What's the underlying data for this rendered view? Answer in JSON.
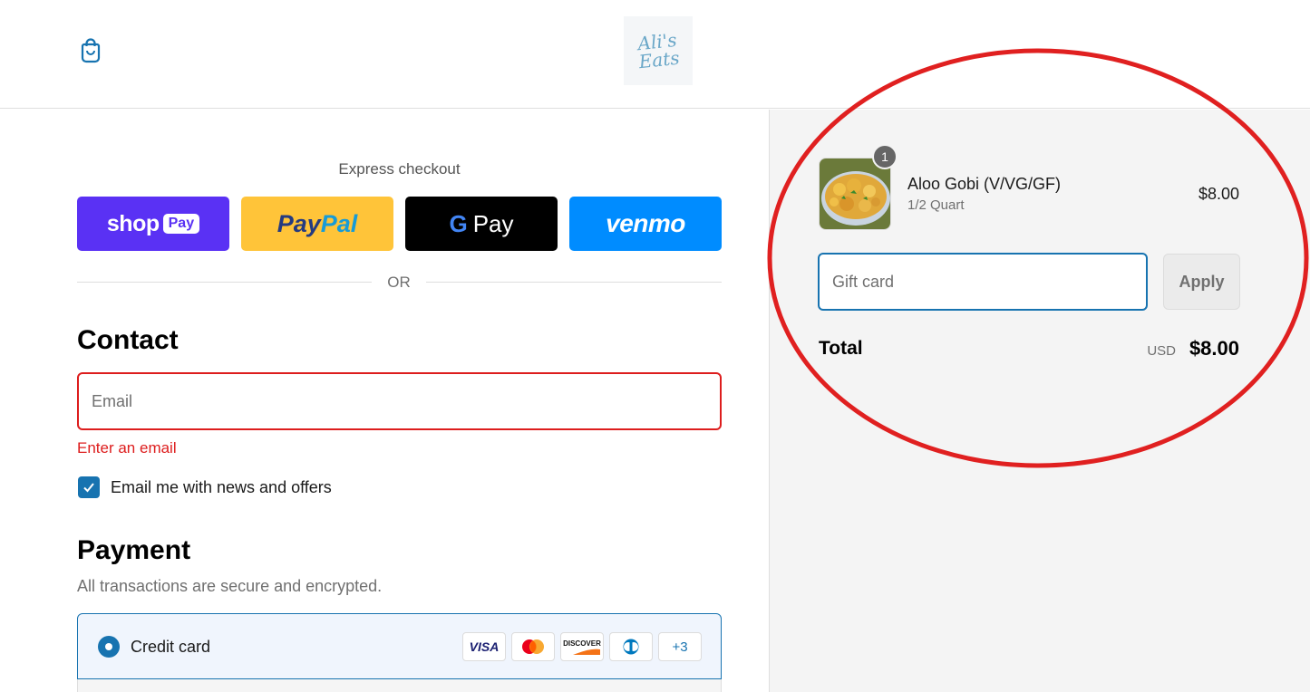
{
  "header": {
    "logo_text": "Ali's Eats",
    "cart_icon": "shopping-bag-icon"
  },
  "express": {
    "title": "Express checkout",
    "shop_pay": {
      "word": "shop",
      "pill": "Pay"
    },
    "paypal": {
      "part1": "Pay",
      "part2": "Pal"
    },
    "google_pay": {
      "g": "G",
      "pay": "Pay"
    },
    "venmo": "venmo",
    "divider": "OR"
  },
  "contact": {
    "heading": "Contact",
    "email_placeholder": "Email",
    "error": "Enter an email",
    "newsletter_label": "Email me with news and offers",
    "newsletter_checked": true
  },
  "payment": {
    "heading": "Payment",
    "subtitle": "All transactions are secure and encrypted.",
    "method_label": "Credit card",
    "cards": [
      "VISA",
      "mastercard",
      "DISCOVER",
      "diners-club"
    ],
    "more_cards": "+3"
  },
  "summary": {
    "item": {
      "name": "Aloo Gobi (V/VG/GF)",
      "variant": "1/2 Quart",
      "price": "$8.00",
      "quantity": "1"
    },
    "gift_card_placeholder": "Gift card",
    "apply_label": "Apply",
    "total_label": "Total",
    "currency": "USD",
    "total_amount": "$8.00"
  },
  "colors": {
    "accent": "#1773b0",
    "error": "#dd1d1d",
    "shop_pay": "#5a31f4",
    "paypal": "#ffc439",
    "venmo": "#008cff",
    "annotation": "#e02020"
  }
}
